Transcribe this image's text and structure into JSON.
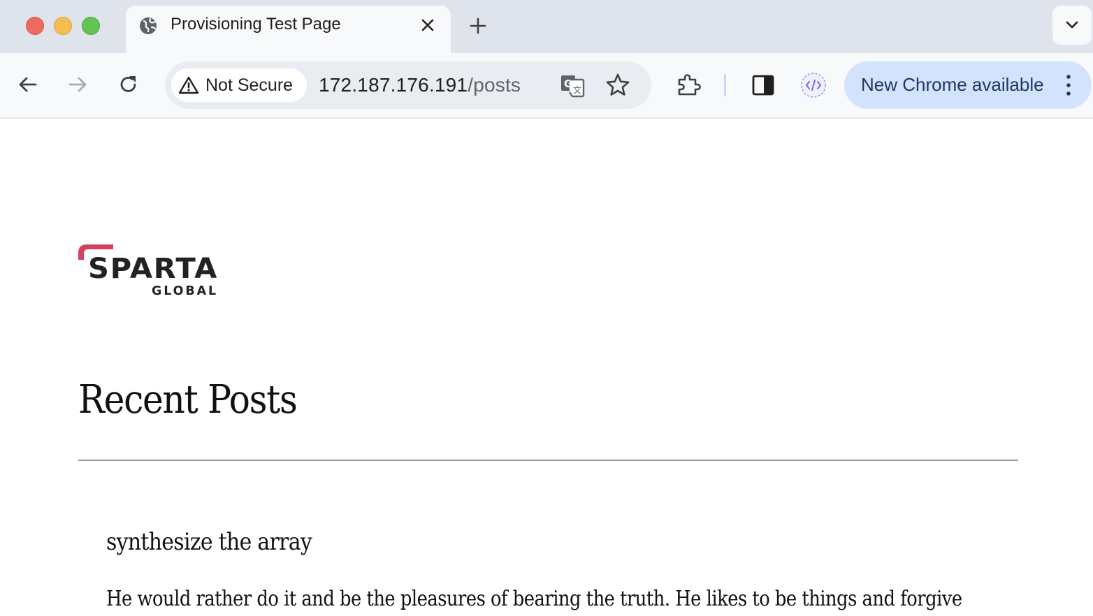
{
  "browser": {
    "tab": {
      "title": "Provisioning Test Page",
      "favicon": "globe-icon"
    },
    "omnibox": {
      "security_label": "Not Secure",
      "url_host": "172.187.176.191",
      "url_path": "/posts"
    },
    "update_label": "New Chrome available",
    "icons": {
      "back": "back-arrow-icon",
      "forward": "forward-arrow-icon",
      "reload": "reload-icon",
      "translate": "translate-icon",
      "bookmark": "star-icon",
      "extensions": "puzzle-icon",
      "side_panel": "side-panel-icon",
      "devtools_extension": "code-icon",
      "menu": "kebab-menu-icon"
    },
    "colors": {
      "tabstrip": "#dfe3ec",
      "toolbar": "#f8f9fb",
      "update_pill": "#d3e3fd"
    }
  },
  "page": {
    "logo": {
      "word": "SPARTA",
      "sub": "GLOBAL",
      "accent": "#d6405f"
    },
    "heading": "Recent Posts",
    "posts": [
      {
        "title": "synthesize the array",
        "body": "He would rather do it and be the pleasures of bearing the truth. He likes to be things and forgive"
      }
    ]
  }
}
